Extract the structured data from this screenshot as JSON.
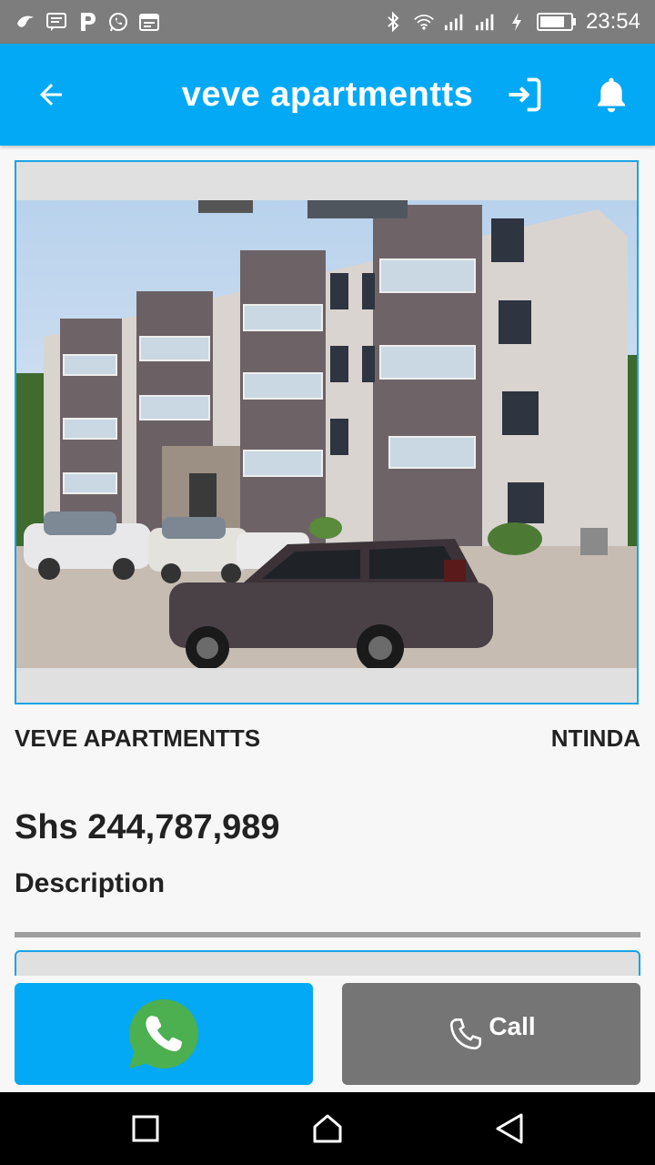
{
  "status_bar": {
    "time": "23:54",
    "left_icons": [
      "bird-icon",
      "message-icon",
      "p-icon",
      "whatsapp-icon",
      "calendar-icon"
    ],
    "right_icons": [
      "bluetooth-icon",
      "wifi-icon",
      "signal-icon",
      "signal-icon",
      "charging-icon",
      "battery-icon"
    ]
  },
  "app_bar": {
    "title": "veve apartmentts",
    "back_icon": "arrow-left-icon",
    "login_icon": "login-icon",
    "notification_icon": "bell-icon"
  },
  "listing": {
    "image_alt": "apartment-building-photo",
    "name": "VEVE APARTMENTTS",
    "location": "NTINDA",
    "price": "Shs 244,787,989",
    "description_heading": "Description"
  },
  "actions": {
    "whatsapp_icon": "whatsapp-icon",
    "call_label": "Call",
    "call_icon": "phone-icon"
  },
  "colors": {
    "primary": "#03a9f4",
    "call_button": "#757575",
    "whatsapp": "#4caf50",
    "status_bar": "#7d7d7d"
  },
  "nav_bar": {
    "items": [
      "recents-square-icon",
      "home-icon",
      "back-triangle-icon"
    ]
  }
}
